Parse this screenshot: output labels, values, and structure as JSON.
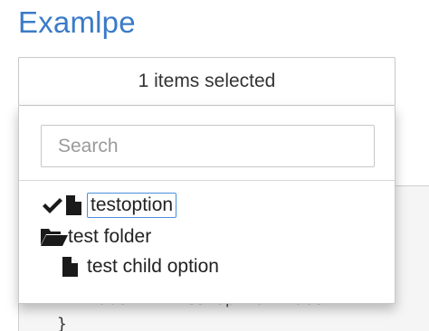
{
  "page": {
    "title": "Examlpe"
  },
  "code": {
    "line1": "label : \"testoption label\"",
    "line2": "}"
  },
  "select": {
    "summary": "1 items selected"
  },
  "dropdown": {
    "search_placeholder": "Search",
    "search_value": "",
    "options": [
      {
        "label": "testoption",
        "icon": "file-icon",
        "selected": true
      },
      {
        "label": "test folder",
        "icon": "folder-open-icon",
        "selected": false
      },
      {
        "label": "test child option",
        "icon": "file-icon",
        "selected": false
      }
    ]
  },
  "colors": {
    "title": "#3a7bc8",
    "focus_border": "#4a90d9"
  }
}
